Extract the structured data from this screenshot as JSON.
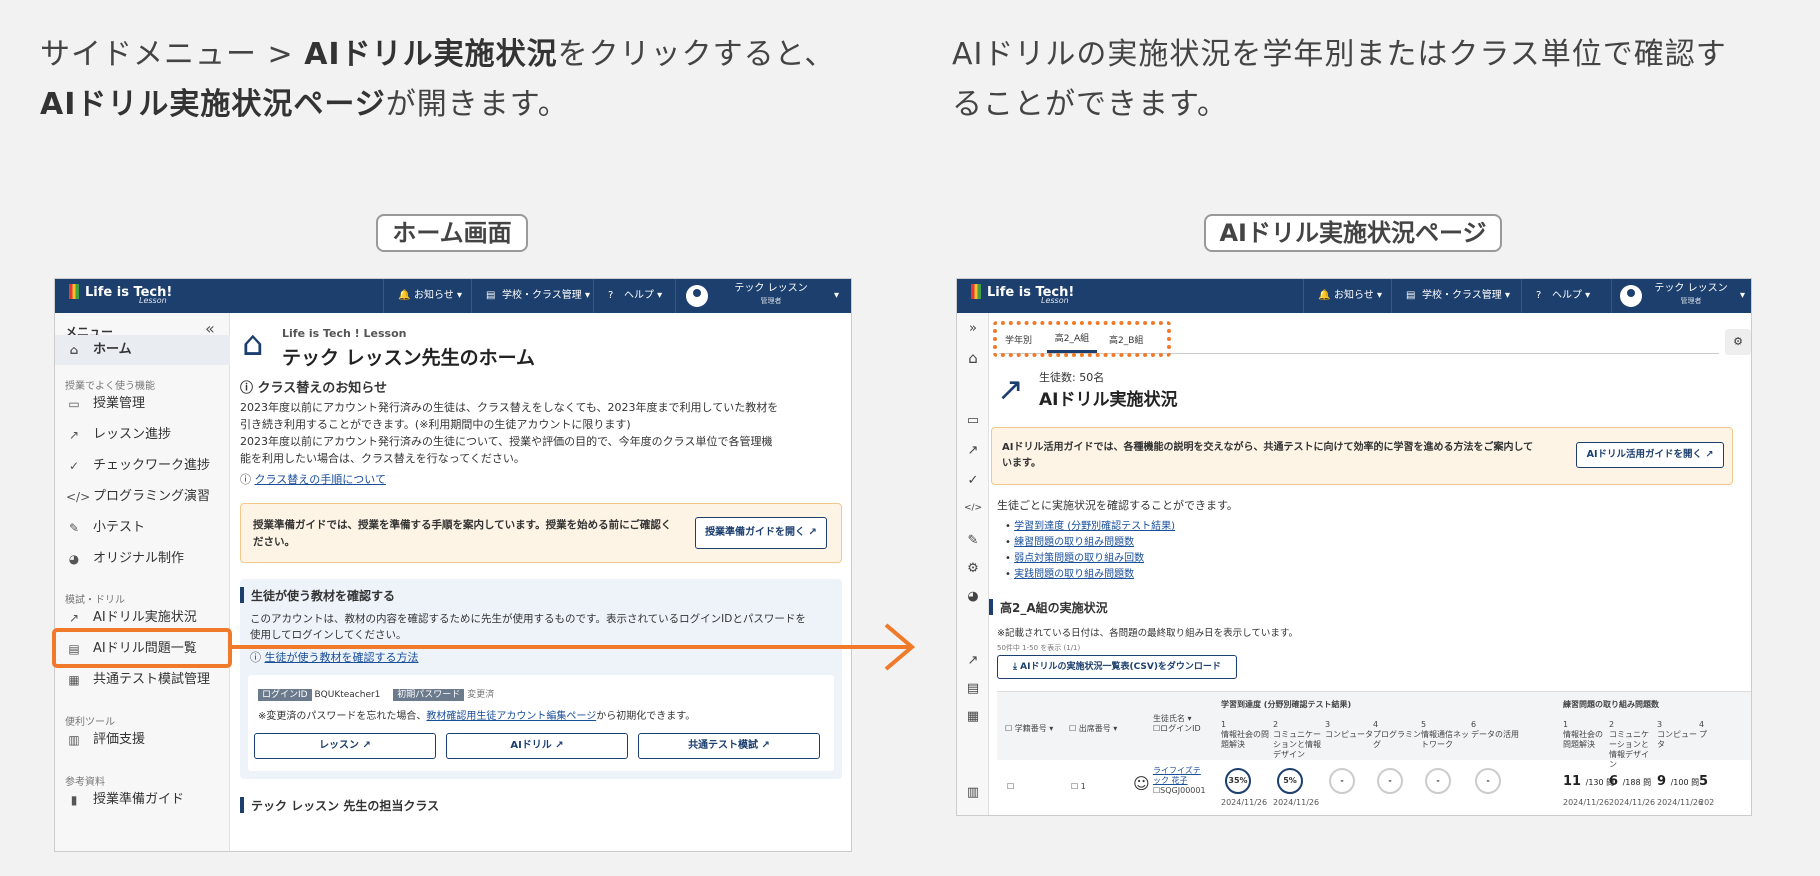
{
  "left_caption": {
    "line1_pre": "サイドメニュー > ",
    "line1_bold": "AIドリル実施状況",
    "line1_post": "をクリックすると、",
    "line2_bold": "AIドリル実施状況ページ",
    "line2_post": "が開きます。"
  },
  "right_caption": {
    "line1": "AIドリルの実施状況を学年別またはクラス単位で確認す",
    "line2": "ることができます。"
  },
  "labels": {
    "home": "ホーム画面",
    "drill": "AIドリル実施状況ページ"
  },
  "header": {
    "logo": "Life is Tech!",
    "logo_sub": "Lesson",
    "notice": "お知らせ",
    "school": "学校・クラス管理",
    "help": "ヘルプ",
    "user_name": "テック レッスン",
    "user_role": "管理者"
  },
  "sidebar": {
    "menu_title": "メニュー",
    "home": "ホーム",
    "group1": "授業でよく使う機能",
    "items1": [
      "授業管理",
      "レッスン進捗",
      "チェックワーク進捗",
      "プログラミング演習",
      "小テスト",
      "オリジナル制作"
    ],
    "group2": "模試・ドリル",
    "items2": [
      "AIドリル実施状況",
      "AIドリル問題一覧",
      "共通テスト模試管理"
    ],
    "group3": "便利ツール",
    "items3": [
      "評価支援"
    ],
    "group4": "参考資料",
    "items4": [
      "授業準備ガイド"
    ]
  },
  "home": {
    "org": "Life is Tech ! Lesson",
    "title": "テック レッスン先生のホーム",
    "notice_title": "クラス替えのお知らせ",
    "notice_l1": "2023年度以前にアカウント発行済みの生徒は、クラス替えをしなくても、2023年度まで利用していた教材を",
    "notice_l2": "引き続き利用することができます。(※利用期間中の生徒アカウントに限ります)",
    "notice_l3": "2023年度以前にアカウント発行済みの生徒について、授業や評価の目的で、今年度のクラス単位で各管理機",
    "notice_l4": "能を利用したい場合は、クラス替えを行なってください。",
    "notice_link": "クラス替えの手順について",
    "guide_text_l1": "授業準備ガイドでは、授業を準備する手順を案内しています。授業を始める前にご確認く",
    "guide_text_l2": "ださい。",
    "guide_btn": "授業準備ガイドを開く",
    "material_title": "生徒が使う教材を確認する",
    "material_l1": "このアカウントは、教材の内容を確認するために先生が使用するものです。表示されているログインIDとパスワードを",
    "material_l2": "使用してログインしてください。",
    "material_link": "生徒が使う教材を確認する方法",
    "login_id_label": "ログインID",
    "login_id": "BQUKteacher1",
    "pw_label": "初期パスワード",
    "pw_value": "変更済",
    "pw_note_pre": "※変更済のパスワードを忘れた場合、",
    "pw_note_link": "教材確認用生徒アカウント編集ページ",
    "pw_note_post": "から初期化できます。",
    "btn_lesson": "レッスン",
    "btn_drill": "AIドリル",
    "btn_test": "共通テスト模試",
    "class_title": "テック レッスン 先生の担当クラス"
  },
  "drill": {
    "tabs": [
      "学年別",
      "高2_A組",
      "高2_B組"
    ],
    "student_count": "生徒数: 50名",
    "title": "AIドリル実施状況",
    "guide_text_l1": "AIドリル活用ガイドでは、各種機能の説明を交えながら、共通テストに向けて効率的に学習を進める方法をご案内して",
    "guide_text_l2": "います。",
    "guide_btn": "AIドリル活用ガイドを開く",
    "desc": "生徒ごとに実施状況を確認することができます。",
    "links": [
      "学習到達度 (分野別確認テスト結果)",
      "練習問題の取り組み問題数",
      "弱点対策問題の取り組み回数",
      "実践問題の取り組み問題数"
    ],
    "section_title": "高2_A組の実施状況",
    "date_note": "※記載されている日付は、各問題の最終取り組み日を表示しています。",
    "paging": "50件中 1-50 を表示 (1/1)",
    "csv_btn": "AIドリルの実施状況一覧表(CSV)をダウンロード",
    "table": {
      "col_grade": "学籍番号",
      "col_seat": "出席番号",
      "col_name": "生徒氏名",
      "col_login": "ログインID",
      "group1": "学習到達度 (分野別確認テスト結果)",
      "group2": "練習問題の取り組み問題数",
      "g1_cols": [
        {
          "n": "1",
          "t": "情報社会の問題解決"
        },
        {
          "n": "2",
          "t": "コミュニケーションと情報デザイン"
        },
        {
          "n": "3",
          "t": "コンピュータ"
        },
        {
          "n": "4",
          "t": "プログラミング"
        },
        {
          "n": "5",
          "t": "情報通信ネットワーク"
        },
        {
          "n": "6",
          "t": "データの活用"
        }
      ],
      "g2_cols": [
        {
          "n": "1",
          "t": "情報社会の問題解決"
        },
        {
          "n": "2",
          "t": "コミュニケーションと情報デザイン"
        },
        {
          "n": "3",
          "t": "コンピュータ"
        },
        {
          "n": "4",
          "t": "プ"
        }
      ],
      "row": {
        "seat": "1",
        "name_l1": "ライフイズテ",
        "name_l2": "ック 花子",
        "login": "SQGJ00001",
        "g1": [
          {
            "v": "35%",
            "d": "2024/11/26"
          },
          {
            "v": "5%",
            "d": "2024/11/26"
          },
          {
            "v": "-",
            "d": ""
          },
          {
            "v": "-",
            "d": ""
          },
          {
            "v": "-",
            "d": ""
          },
          {
            "v": "-",
            "d": ""
          }
        ],
        "g2": [
          {
            "v": "11",
            "of": "/130 問",
            "d": "2024/11/26"
          },
          {
            "v": "6",
            "of": "/188 問",
            "d": "2024/11/26"
          },
          {
            "v": "9",
            "of": "/100 問",
            "d": "2024/11/26"
          },
          {
            "v": "5",
            "of": "",
            "d": "202"
          }
        ]
      }
    }
  },
  "colors": {
    "header": "#1c3f6e",
    "highlight": "#f07a2a",
    "note_bg": "#fdf4e6"
  }
}
